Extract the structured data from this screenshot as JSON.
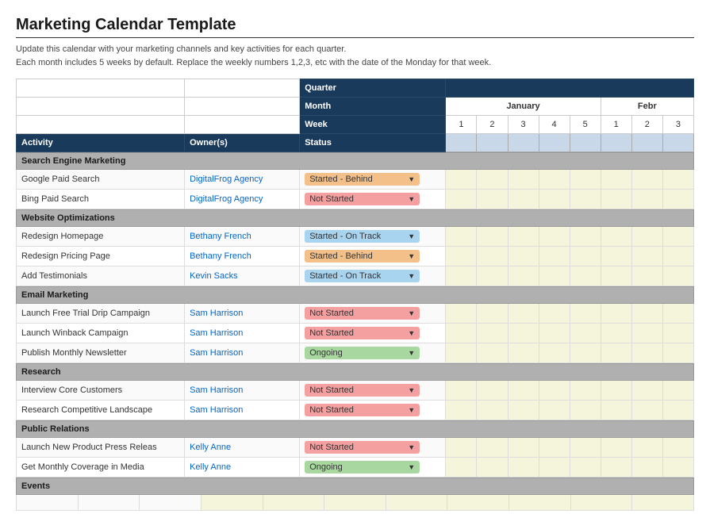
{
  "title": "Marketing Calendar Template",
  "subtitle_line1": "Update this calendar with your marketing channels and key activities for each quarter.",
  "subtitle_line2": "Each month includes 5 weeks by default. Replace the weekly numbers 1,2,3, etc with the date of the Monday for that week.",
  "header": {
    "quarter_label": "Quarter",
    "month_label": "Month",
    "week_label": "Week",
    "quarter_value": "",
    "january_label": "January",
    "february_label": "Febr",
    "jan_weeks": [
      "1",
      "2",
      "3",
      "4",
      "5"
    ],
    "feb_weeks": [
      "1",
      "2",
      "3"
    ]
  },
  "col_headers": {
    "activity": "Activity",
    "owner": "Owner(s)",
    "status": "Status"
  },
  "sections": [
    {
      "name": "Search Engine Marketing",
      "rows": [
        {
          "activity": "Google Paid Search",
          "owner": "DigitalFrog Agency",
          "status": "Started - Behind",
          "status_class": "status-behind",
          "weeks": [
            false,
            false,
            false,
            false,
            false,
            false,
            false,
            false
          ]
        },
        {
          "activity": "Bing Paid Search",
          "owner": "DigitalFrog Agency",
          "status": "Not Started",
          "status_class": "status-not-started",
          "weeks": [
            false,
            false,
            false,
            false,
            false,
            false,
            false,
            false
          ]
        }
      ]
    },
    {
      "name": "Website Optimizations",
      "rows": [
        {
          "activity": "Redesign Homepage",
          "owner": "Bethany French",
          "status": "Started - On Track",
          "status_class": "status-on-track",
          "weeks": [
            false,
            false,
            false,
            false,
            false,
            false,
            false,
            false
          ]
        },
        {
          "activity": "Redesign Pricing Page",
          "owner": "Bethany French",
          "status": "Started - Behind",
          "status_class": "status-behind",
          "weeks": [
            false,
            false,
            false,
            false,
            false,
            false,
            false,
            false
          ]
        },
        {
          "activity": "Add Testimonials",
          "owner": "Kevin Sacks",
          "status": "Started - On Track",
          "status_class": "status-on-track",
          "weeks": [
            false,
            false,
            false,
            false,
            false,
            false,
            false,
            false
          ]
        }
      ]
    },
    {
      "name": "Email Marketing",
      "rows": [
        {
          "activity": "Launch Free Trial Drip Campaign",
          "owner": "Sam Harrison",
          "status": "Not Started",
          "status_class": "status-not-started",
          "weeks": [
            false,
            false,
            false,
            false,
            false,
            false,
            false,
            false
          ]
        },
        {
          "activity": "Launch Winback Campaign",
          "owner": "Sam Harrison",
          "status": "Not Started",
          "status_class": "status-not-started",
          "weeks": [
            false,
            false,
            false,
            false,
            false,
            false,
            false,
            false
          ]
        },
        {
          "activity": "Publish Monthly Newsletter",
          "owner": "Sam Harrison",
          "status": "Ongoing",
          "status_class": "status-ongoing",
          "weeks": [
            false,
            false,
            false,
            false,
            false,
            false,
            false,
            false
          ]
        }
      ]
    },
    {
      "name": "Research",
      "rows": [
        {
          "activity": "Interview Core Customers",
          "owner": "Sam Harrison",
          "status": "Not Started",
          "status_class": "status-not-started",
          "weeks": [
            false,
            false,
            false,
            false,
            false,
            false,
            false,
            false
          ]
        },
        {
          "activity": "Research Competitive Landscape",
          "owner": "Sam Harrison",
          "status": "Not Started",
          "status_class": "status-not-started",
          "weeks": [
            false,
            false,
            false,
            false,
            false,
            false,
            false,
            false
          ]
        }
      ]
    },
    {
      "name": "Public Relations",
      "rows": [
        {
          "activity": "Launch New Product Press Releas",
          "owner": "Kelly Anne",
          "status": "Not Started",
          "status_class": "status-not-started",
          "weeks": [
            false,
            false,
            false,
            false,
            false,
            false,
            false,
            false
          ]
        },
        {
          "activity": "Get Monthly Coverage in Media",
          "owner": "Kelly Anne",
          "status": "Ongoing",
          "status_class": "status-ongoing",
          "weeks": [
            false,
            false,
            false,
            false,
            false,
            false,
            false,
            false
          ]
        }
      ]
    },
    {
      "name": "Events",
      "rows": []
    }
  ]
}
